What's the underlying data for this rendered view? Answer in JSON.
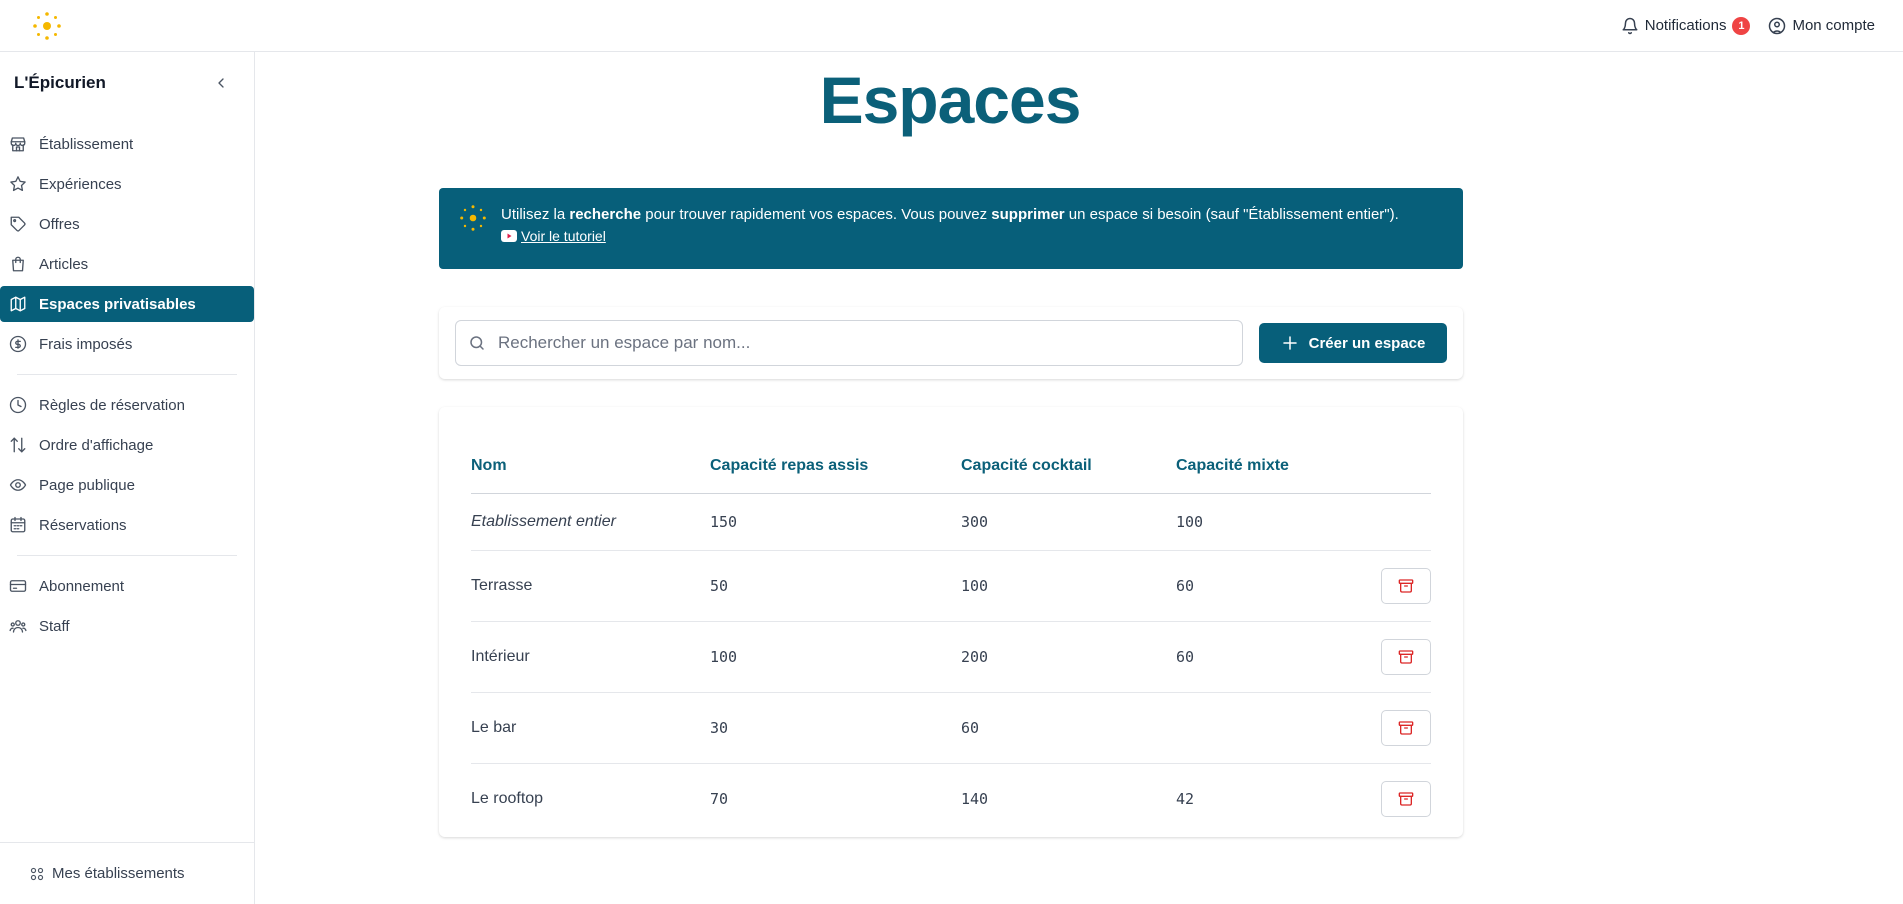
{
  "topbar": {
    "notifications_label": "Notifications",
    "notifications_count": "1",
    "account_label": "Mon compte",
    "brand_color": "#f5b800"
  },
  "sidebar": {
    "title": "L'Épicurien",
    "groups": [
      [
        {
          "label": "Établissement",
          "icon": "store-icon",
          "active": false
        },
        {
          "label": "Expériences",
          "icon": "star-icon",
          "active": false
        },
        {
          "label": "Offres",
          "icon": "tag-icon",
          "active": false
        },
        {
          "label": "Articles",
          "icon": "shopping-bag-icon",
          "active": false
        },
        {
          "label": "Espaces privatisables",
          "icon": "map-icon",
          "active": true
        },
        {
          "label": "Frais imposés",
          "icon": "dollar-circle-icon",
          "active": false
        }
      ],
      [
        {
          "label": "Règles de réservation",
          "icon": "clock-icon",
          "active": false
        },
        {
          "label": "Ordre d'affichage",
          "icon": "sort-arrows-icon",
          "active": false
        },
        {
          "label": "Page publique",
          "icon": "eye-icon",
          "active": false
        },
        {
          "label": "Réservations",
          "icon": "calendar-icon",
          "active": false
        }
      ],
      [
        {
          "label": "Abonnement",
          "icon": "credit-card-icon",
          "active": false
        },
        {
          "label": "Staff",
          "icon": "users-icon",
          "active": false
        }
      ]
    ],
    "footer_label": "Mes établissements",
    "accent_color": "#075f7a"
  },
  "main": {
    "title": "Espaces",
    "info": {
      "t1": "Utilisez la ",
      "b1": "recherche",
      "t2": " pour trouver rapidement vos espaces. Vous pouvez ",
      "b2": "supprimer",
      "t3": " un espace si besoin (sauf \"Établissement entier\").",
      "tutorial_link": "Voir le tutoriel"
    },
    "search": {
      "placeholder": "Rechercher un espace par nom...",
      "value": ""
    },
    "create_button": "Créer un espace",
    "table": {
      "headers": [
        "Nom",
        "Capacité repas assis",
        "Capacité cocktail",
        "Capacité mixte"
      ],
      "rows": [
        {
          "name": "Etablissement entier",
          "repas": "150",
          "cocktail": "300",
          "mixte": "100",
          "deletable": false
        },
        {
          "name": "Terrasse",
          "repas": "50",
          "cocktail": "100",
          "mixte": "60",
          "deletable": true
        },
        {
          "name": "Intérieur",
          "repas": "100",
          "cocktail": "200",
          "mixte": "60",
          "deletable": true
        },
        {
          "name": "Le bar",
          "repas": "30",
          "cocktail": "60",
          "mixte": "",
          "deletable": true
        },
        {
          "name": "Le rooftop",
          "repas": "70",
          "cocktail": "140",
          "mixte": "42",
          "deletable": true
        }
      ]
    }
  }
}
